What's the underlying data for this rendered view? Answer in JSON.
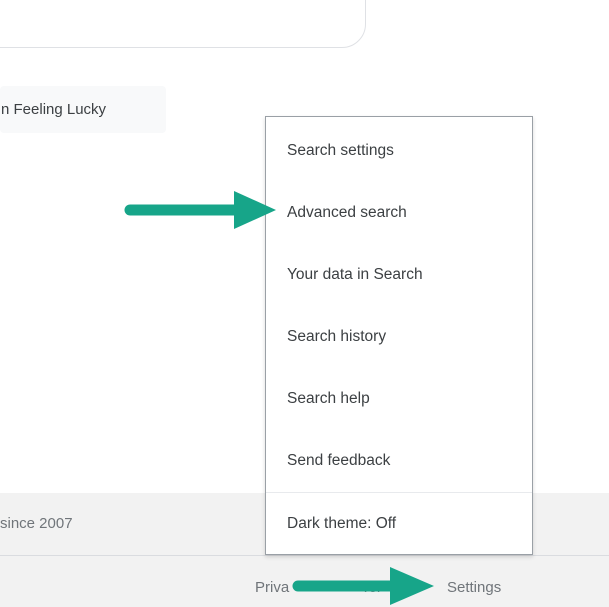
{
  "lucky_button": {
    "label": "n Feeling Lucky"
  },
  "footer": {
    "since": "since 2007",
    "links": {
      "privacy": "Priva",
      "terms": "Ter",
      "settings": "Settings"
    }
  },
  "menu": {
    "items": [
      {
        "label": "Search settings"
      },
      {
        "label": "Advanced search"
      },
      {
        "label": "Your data in Search"
      },
      {
        "label": "Search history"
      },
      {
        "label": "Search help"
      },
      {
        "label": "Send feedback"
      }
    ],
    "dark_theme": {
      "label": "Dark theme: Off"
    }
  },
  "colors": {
    "arrow": "#17a589",
    "footer_bg": "#f2f2f2",
    "menu_border": "#9aa0a6",
    "text": "#3c4043",
    "muted_text": "#70757a"
  },
  "icons": [
    "arrow-right-icon"
  ]
}
